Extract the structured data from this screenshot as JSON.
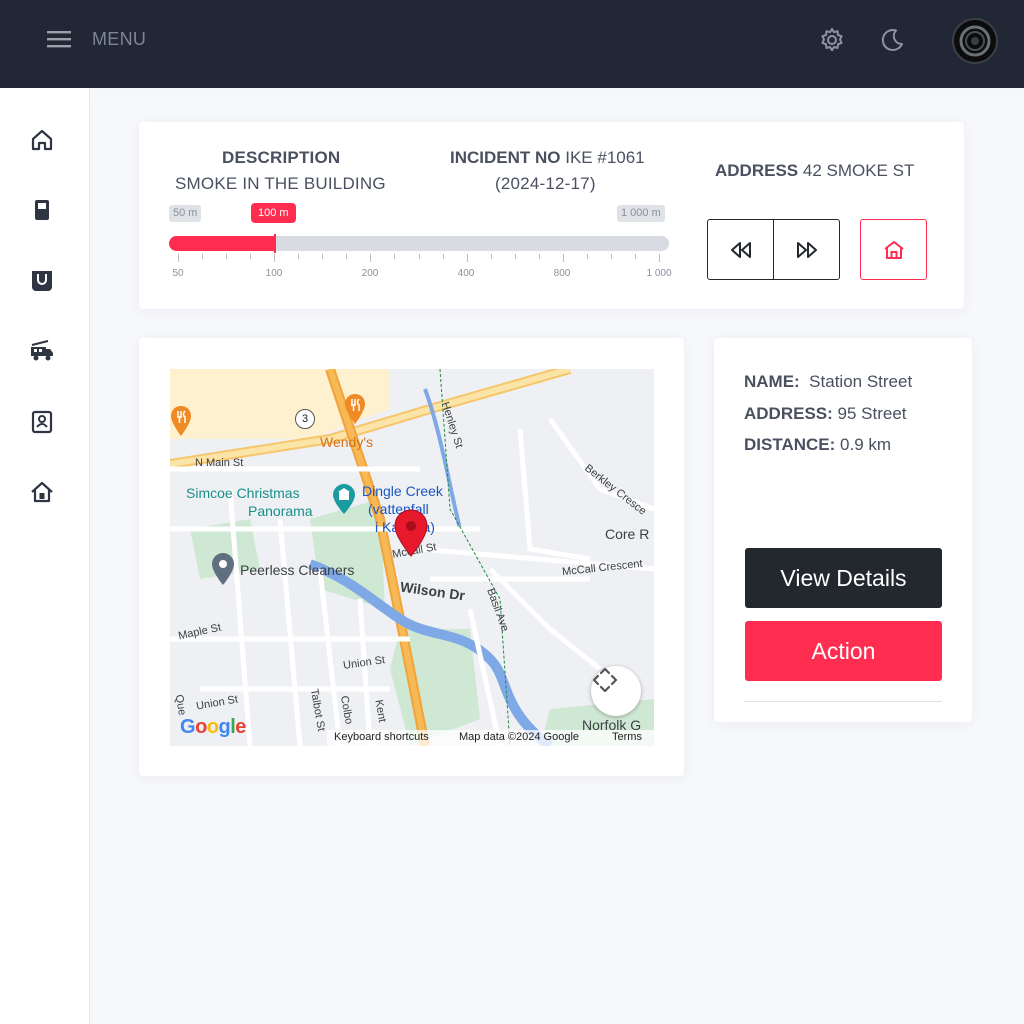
{
  "topbar": {
    "menu_label": "MENU",
    "icons": [
      "menu-icon",
      "gear-icon",
      "moon-icon",
      "avatar"
    ]
  },
  "sidebar": {
    "items": [
      "home-icon",
      "fuel-icon",
      "pocket-icon",
      "fire-truck-icon",
      "contact-icon",
      "station-icon"
    ]
  },
  "incident": {
    "description_title": "DESCRIPTION",
    "description_text": "SMOKE IN THE BUILDING",
    "incident_title": "INCIDENT NO",
    "incident_number": "IKE #1061",
    "incident_date": "(2024-12-17)",
    "address_title": "ADDRESS",
    "address_value": "42  SMOKE  ST"
  },
  "range": {
    "min_label": "50 m",
    "max_label": "1 000 m",
    "value_label": "100 m",
    "value_fraction": 0.21,
    "ticks": [
      "50",
      "100",
      "200",
      "400",
      "800",
      "1 000"
    ]
  },
  "map": {
    "labels": {
      "wendys": "Wendy's",
      "n_main": "N Main St",
      "simcoe": "Simcoe Christmas",
      "panorama": "Panorama",
      "dingle": "Dingle Creek",
      "vattenfall": "(vattenfall",
      "kanada": "i Kanada)",
      "core": "Core R",
      "mccall": "Mccall St",
      "mccall_cres": "McCall Crescent",
      "peerless": "Peerless Cleaners",
      "wilson": "Wilson Dr",
      "maple": "Maple St",
      "union1": "Union St",
      "union2": "Union St",
      "talbot": "Talbot St",
      "colborne": "Colbo",
      "kent": "Kent",
      "henley": "Henley St",
      "berkley": "Berkley Cresce",
      "basil": "Basil Ave",
      "norfolk": "Norfolk G",
      "queen": "Que",
      "route": "3",
      "google": "Google",
      "keyboard": "Keyboard shortcuts",
      "mapdata": "Map data ©2024 Google",
      "terms": "Terms"
    }
  },
  "station": {
    "name_label": "NAME:",
    "name_value": "Station Street",
    "address_label": "ADDRESS:",
    "address_value": "95  Street",
    "distance_label": "DISTANCE:",
    "distance_value": "0.9 km",
    "view_details": "View Details",
    "action": "Action"
  },
  "colors": {
    "accent": "#ff2d4f",
    "dark": "#23272e",
    "topbar": "#212735"
  }
}
